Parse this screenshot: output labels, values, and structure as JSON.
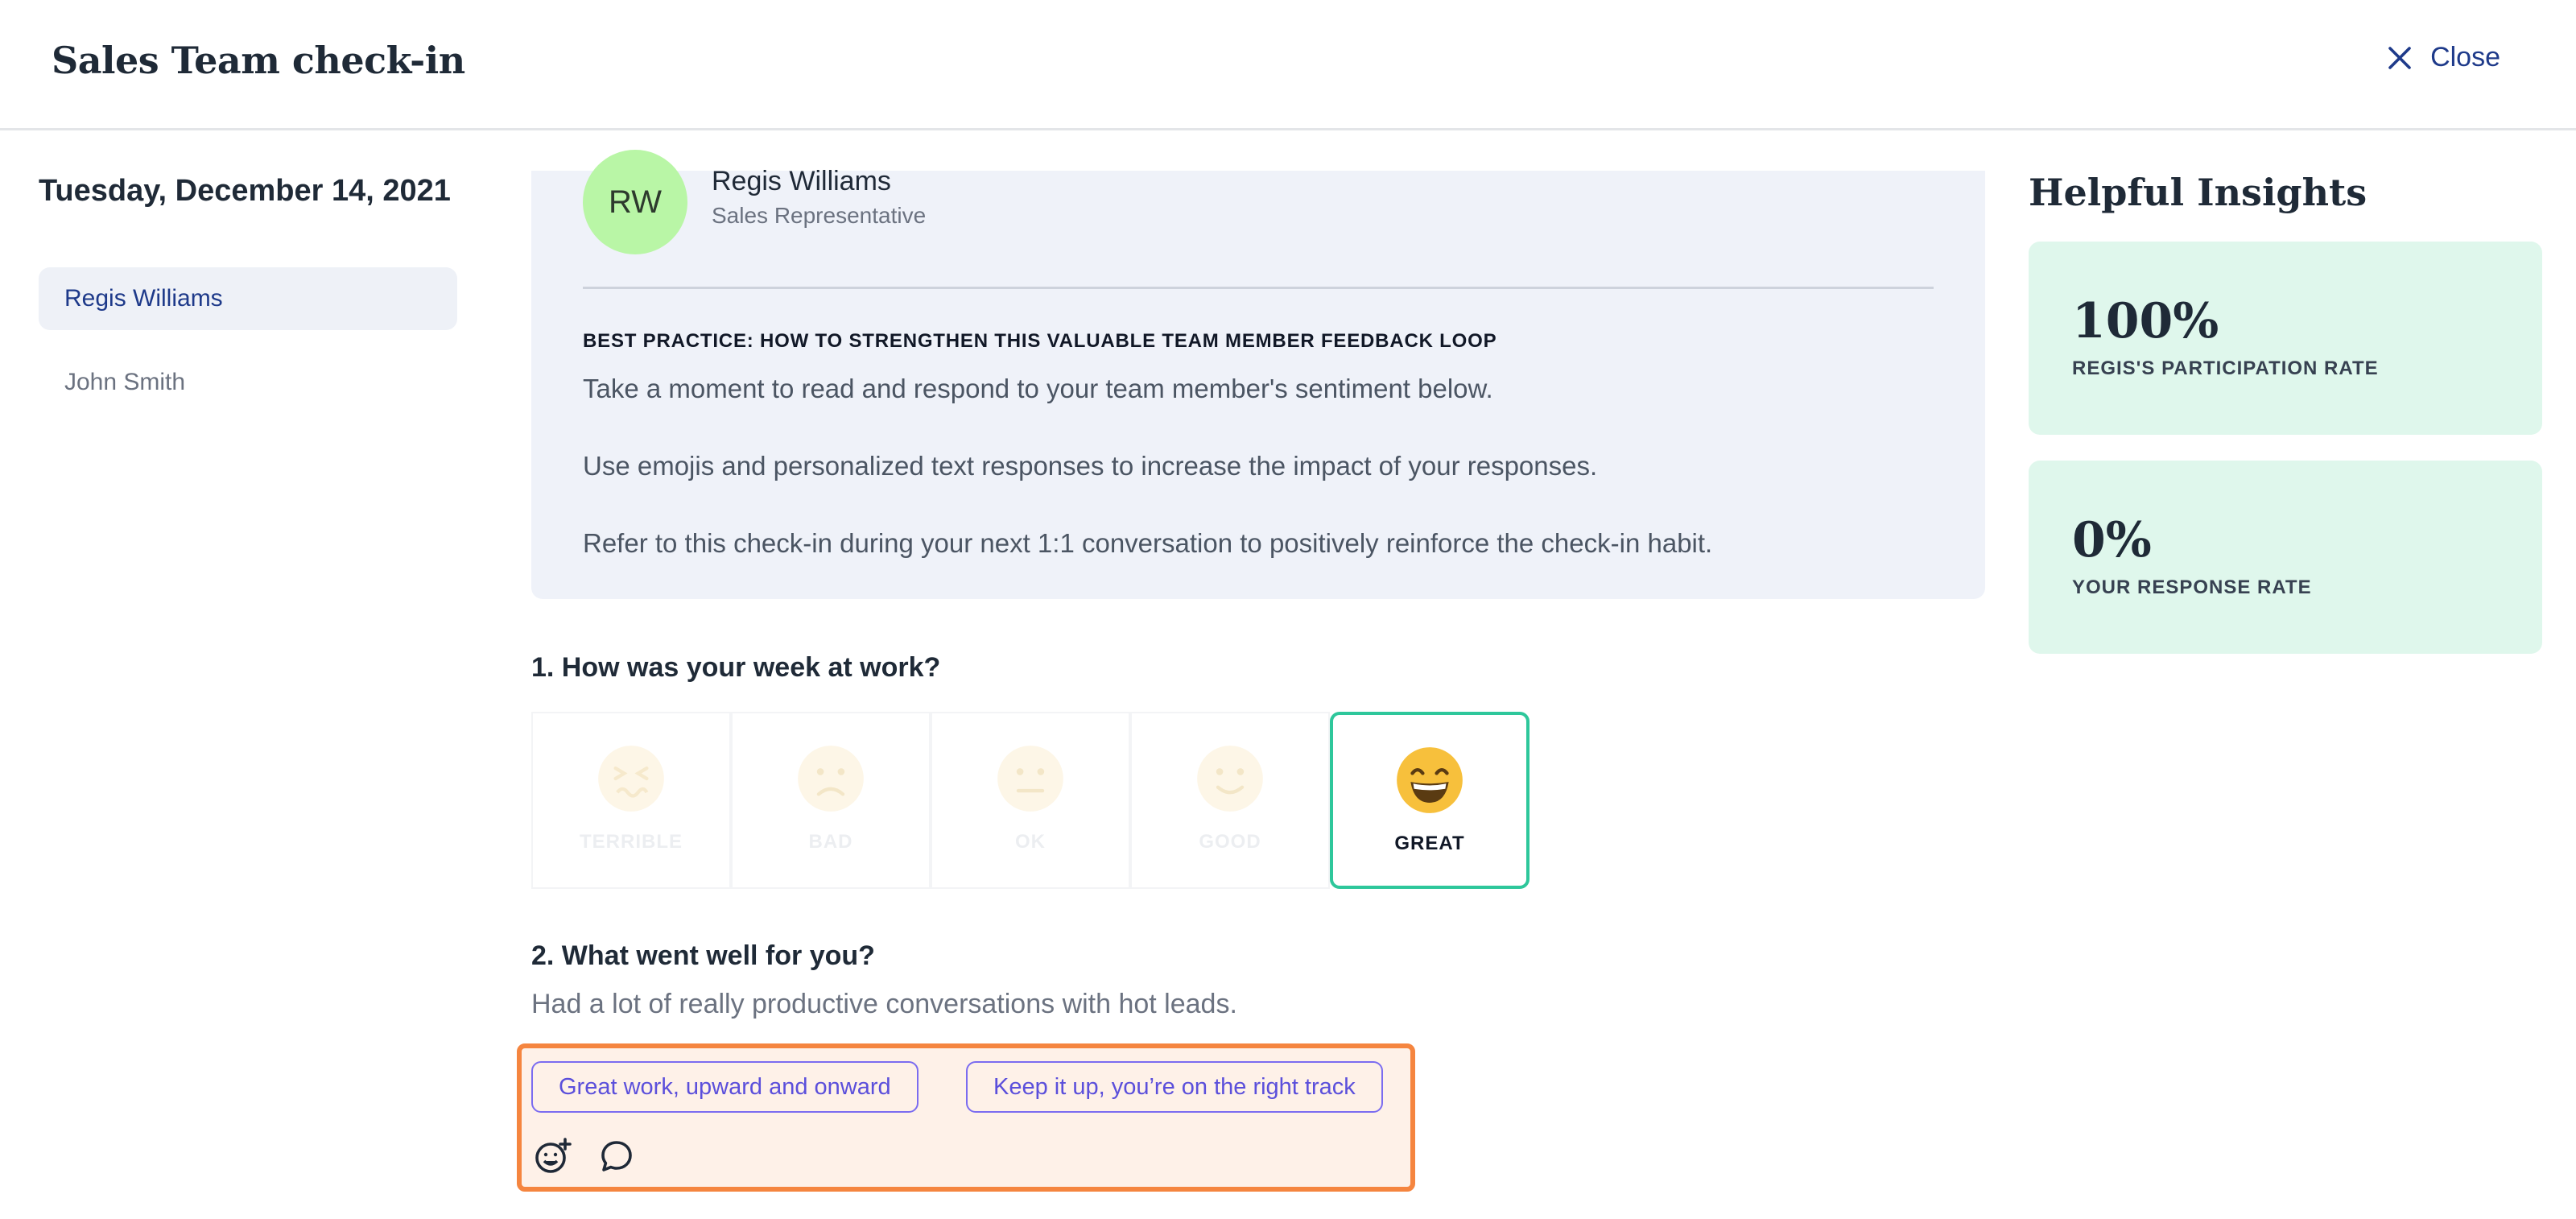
{
  "header": {
    "title": "Sales Team check-in",
    "close_label": "Close",
    "close_icon": "close-icon"
  },
  "sidebar": {
    "date": "Tuesday, December 14, 2021",
    "members": [
      {
        "name": "Regis Williams",
        "active": true
      },
      {
        "name": "John Smith",
        "active": false
      }
    ]
  },
  "profile": {
    "initials": "RW",
    "name": "Regis Williams",
    "role": "Sales Representative",
    "avatar_color": "#b9f6a6"
  },
  "best_practice": {
    "heading": "BEST PRACTICE: HOW TO STRENGTHEN THIS VALUABLE TEAM MEMBER FEEDBACK LOOP",
    "lines": [
      "Take a moment to read and respond to your team member's sentiment below.",
      "Use emojis and personalized text responses to increase the impact of your responses.",
      "Refer to this check-in during your next 1:1 conversation to positively reinforce the check-in habit."
    ]
  },
  "question1": {
    "text": "1. How was your week at work?",
    "options": [
      {
        "label": "TERRIBLE",
        "icon": "terrible-face-icon"
      },
      {
        "label": "BAD",
        "icon": "sad-face-icon"
      },
      {
        "label": "OK",
        "icon": "neutral-face-icon"
      },
      {
        "label": "GOOD",
        "icon": "smile-face-icon"
      },
      {
        "label": "GREAT",
        "icon": "grin-face-icon"
      }
    ],
    "selected": "GREAT",
    "selected_color": "#2ec79b"
  },
  "question2": {
    "text": "2. What went well for you?",
    "answer": "Had a lot of really productive conversations with hot leads."
  },
  "response": {
    "suggestions": [
      "Great work, upward and onward",
      "Keep it up, you’re on the right track"
    ],
    "icons": [
      "add-emoji-icon",
      "comment-icon"
    ],
    "highlight_color": "#f5853f"
  },
  "insights": {
    "title": "Helpful Insights",
    "stats": [
      {
        "value": "100%",
        "label": "REGIS'S PARTICIPATION RATE"
      },
      {
        "value": "0%",
        "label": "YOUR RESPONSE RATE"
      }
    ],
    "card_color": "#dff7ec"
  }
}
